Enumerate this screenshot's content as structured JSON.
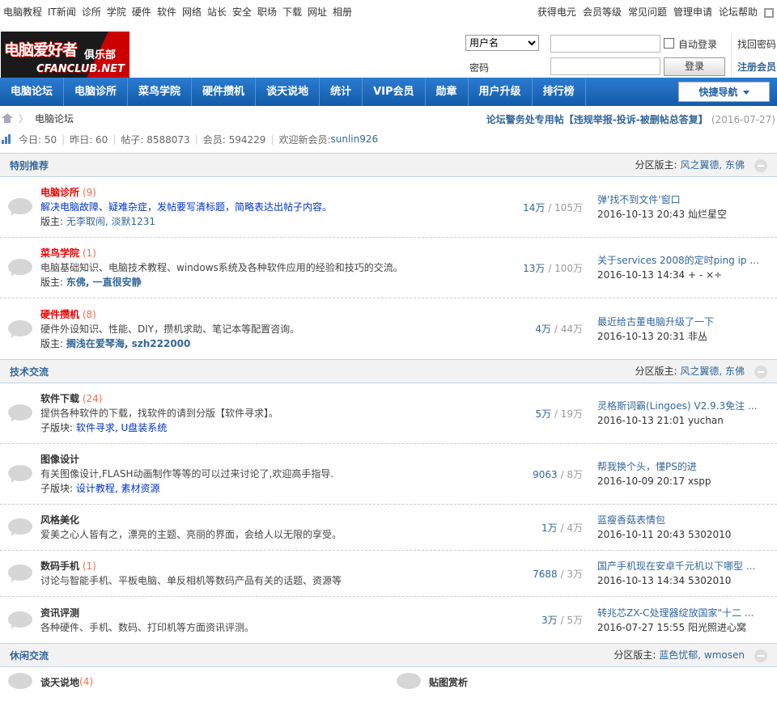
{
  "topbar": {
    "left": [
      "电脑教程",
      "IT新闻",
      "诊所",
      "学院",
      "硬件",
      "软件",
      "网络",
      "站长",
      "安全",
      "职场",
      "下载",
      "网址",
      "相册"
    ],
    "right": [
      "获得电元",
      "会员等级",
      "常见问题",
      "管理申请",
      "论坛帮助"
    ]
  },
  "logo": {
    "main": "电脑爱好者",
    "sub": "俱乐部",
    "url": "CFANCLUB.NET"
  },
  "login": {
    "select_value": "用户名",
    "password_label": "密码",
    "auto_login": "自动登录",
    "login_button": "登录",
    "find_password": "找回密码",
    "register": "注册会员"
  },
  "nav": {
    "items": [
      "电脑论坛",
      "电脑诊所",
      "菜鸟学院",
      "硬件攒机",
      "谈天说地",
      "统计",
      "VIP会员",
      "勋章",
      "用户升级",
      "排行榜"
    ],
    "quick": "快捷导航"
  },
  "breadcrumb": {
    "current": "电脑论坛",
    "notice": "论坛警务处专用帖【违规举报-投诉-被删帖总答复】",
    "notice_date": "(2016-07-27)"
  },
  "stats": {
    "today": "今日: 50",
    "yesterday": "昨日: 60",
    "posts": "帖子: 8588073",
    "members": "会员: 594229",
    "welcome": "欢迎新会员: ",
    "new_member": "sunlin926"
  },
  "sections": [
    {
      "title": "特别推荐",
      "mods_label": "分区版主: ",
      "mods": "风之翼德, 东佛",
      "forums": [
        {
          "name": "电脑诊所",
          "count": " (9)",
          "red": true,
          "desc": "解决电脑故障、疑难杂症，发帖要写清标题，简略表达出帖子内容。",
          "desc_blue": true,
          "mod_label": "版主: ",
          "mods": "无李取闹, 淡默1231",
          "mods_bold": false,
          "threads": "14万",
          "posts": "105万",
          "last_title": "弹'找不到文件'窗口",
          "last_meta": "2016-10-13 20:43 灿烂星空"
        },
        {
          "name": "菜鸟学院",
          "count": " (1)",
          "red": true,
          "desc": "电脑基础知识、电脑技术教程、windows系统及各种软件应用的经验和技巧的交流。",
          "desc_blue": false,
          "mod_label": "版主: ",
          "mods": "东佛, 一直很安静",
          "mods_bold": true,
          "threads": "13万",
          "posts": "100万",
          "last_title": "关于services 2008的定时ping ip ...",
          "last_meta": "2016-10-13 14:34 + - ×÷"
        },
        {
          "name": "硬件攒机",
          "count": " (8)",
          "red": true,
          "desc": "硬件外设知识、性能、DIY，攒机求助、笔记本等配置咨询。",
          "desc_blue": false,
          "mod_label": "版主: ",
          "mods": "搁浅在爱琴海, szh222000",
          "mods_bold": true,
          "threads": "4万",
          "posts": "44万",
          "last_title": "最近给古董电脑升级了一下",
          "last_meta": "2016-10-13 20:31 非丛"
        }
      ]
    },
    {
      "title": "技术交流",
      "mods_label": "分区版主: ",
      "mods": "风之翼德, 东佛",
      "forums": [
        {
          "name": "软件下载",
          "count": " (24)",
          "red": false,
          "desc": "提供各种软件的下载，找软件的请到分版【软件寻求】。",
          "desc_blue": false,
          "mod_label": "子版块: ",
          "mods": "软件寻求, U盘装系统",
          "mods_bold": false,
          "threads": "5万",
          "posts": "19万",
          "last_title": "灵格斯词霸(Lingoes) V2.9.3免注 ...",
          "last_meta": "2016-10-13 21:01 yuchan"
        },
        {
          "name": "图像设计",
          "count": "",
          "red": false,
          "desc": "有关图像设计,FLASH动画制作等等的可以过来讨论了,欢迎高手指导.",
          "desc_blue": false,
          "mod_label": "子版块: ",
          "mods": "设计教程, 素材资源",
          "mods_bold": false,
          "threads": "9063",
          "posts": "8万",
          "last_title": "帮我换个头，懂PS的进",
          "last_meta": "2016-10-09 20:17 xspp"
        },
        {
          "name": "风格美化",
          "count": "",
          "red": false,
          "desc": "爱美之心人皆有之，漂亮的主题、亮丽的界面，会给人以无限的享受。",
          "desc_blue": false,
          "mod_label": "",
          "mods": "",
          "mods_bold": false,
          "threads": "1万",
          "posts": "4万",
          "last_title": "蓝瘦香菇表情包",
          "last_meta": "2016-10-11 20:43 5302010"
        },
        {
          "name": "数码手机",
          "count": " (1)",
          "red": false,
          "desc": "讨论与智能手机、平板电脑、单反相机等数码产品有关的话题、资源等",
          "desc_blue": false,
          "mod_label": "",
          "mods": "",
          "mods_bold": false,
          "threads": "7688",
          "posts": "3万",
          "last_title": "国产手机现在安卓千元机以下哪型 ...",
          "last_meta": "2016-10-13 14:34 5302010"
        },
        {
          "name": "资讯评测",
          "count": "",
          "red": false,
          "desc": "各种硬件、手机、数码、打印机等方面资讯评测。",
          "desc_blue": false,
          "mod_label": "",
          "mods": "",
          "mods_bold": false,
          "threads": "3万",
          "posts": "5万",
          "last_title": "转兆芯ZX-C处理器绽放国家\"十二 ...",
          "last_meta": "2016-07-27 15:55 阳光照进心窝"
        }
      ]
    },
    {
      "title": "休闲交流",
      "mods_label": "分区版主: ",
      "mods": "蓝色忧郁, wmosen",
      "half_forums": [
        {
          "name": "谈天说地",
          "count": " (4)"
        },
        {
          "name": "贴图赏析",
          "count": ""
        }
      ]
    }
  ]
}
